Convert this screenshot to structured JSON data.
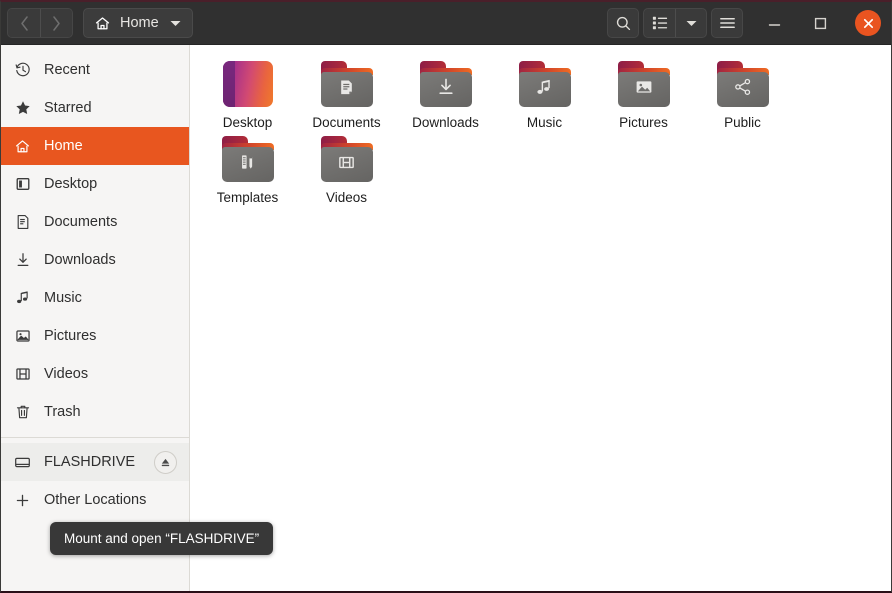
{
  "window": {
    "title": "Home",
    "titlebar": {
      "back_label": "Back",
      "forward_label": "Forward",
      "path_label": "Home",
      "path_icon": "home-icon",
      "caret_icon": "chevron-down-icon",
      "search_icon": "search-icon",
      "view_list_icon": "list-view-icon",
      "view_caret_icon": "chevron-down-icon",
      "menu_icon": "hamburger-menu-icon",
      "minimize_label": "Minimize",
      "maximize_label": "Maximize",
      "close_label": "Close"
    },
    "colors": {
      "headerbar_bg": "#303030",
      "sidebar_bg": "#f6f5f4",
      "content_bg": "#ffffff",
      "accent": "#e8561f",
      "close_button": "#e95420",
      "tooltip_bg": "#383838",
      "folder_gray": "#6f6e6c",
      "folder_top": "#d2462a"
    }
  },
  "sidebar": {
    "items": [
      {
        "label": "Recent",
        "icon": "clock-icon",
        "active": false
      },
      {
        "label": "Starred",
        "icon": "star-icon",
        "active": false
      },
      {
        "label": "Home",
        "icon": "home-icon",
        "active": true
      },
      {
        "label": "Desktop",
        "icon": "monitor-icon",
        "active": false
      },
      {
        "label": "Documents",
        "icon": "document-icon",
        "active": false
      },
      {
        "label": "Downloads",
        "icon": "download-icon",
        "active": false
      },
      {
        "label": "Music",
        "icon": "music-note-icon",
        "active": false
      },
      {
        "label": "Pictures",
        "icon": "image-icon",
        "active": false
      },
      {
        "label": "Videos",
        "icon": "film-icon",
        "active": false
      },
      {
        "label": "Trash",
        "icon": "trash-icon",
        "active": false
      }
    ],
    "devices": [
      {
        "label": "FLASHDRIVE",
        "icon": "drive-icon",
        "eject_icon": "eject-icon",
        "hover": true
      }
    ],
    "other_locations": {
      "label": "Other Locations",
      "icon": "plus-icon"
    }
  },
  "tooltip": {
    "visible": true,
    "text": "Mount and open “FLASHDRIVE”"
  },
  "content": {
    "files": [
      {
        "name": "Desktop",
        "icon": "desktop-gradient-icon",
        "kind": "special"
      },
      {
        "name": "Documents",
        "icon": "document-icon",
        "kind": "folder"
      },
      {
        "name": "Downloads",
        "icon": "download-icon",
        "kind": "folder"
      },
      {
        "name": "Music",
        "icon": "music-note-icon",
        "kind": "folder"
      },
      {
        "name": "Pictures",
        "icon": "image-icon",
        "kind": "folder"
      },
      {
        "name": "Public",
        "icon": "share-nodes-icon",
        "kind": "folder"
      },
      {
        "name": "Templates",
        "icon": "template-icon",
        "kind": "folder"
      },
      {
        "name": "Videos",
        "icon": "film-icon",
        "kind": "folder"
      }
    ]
  }
}
